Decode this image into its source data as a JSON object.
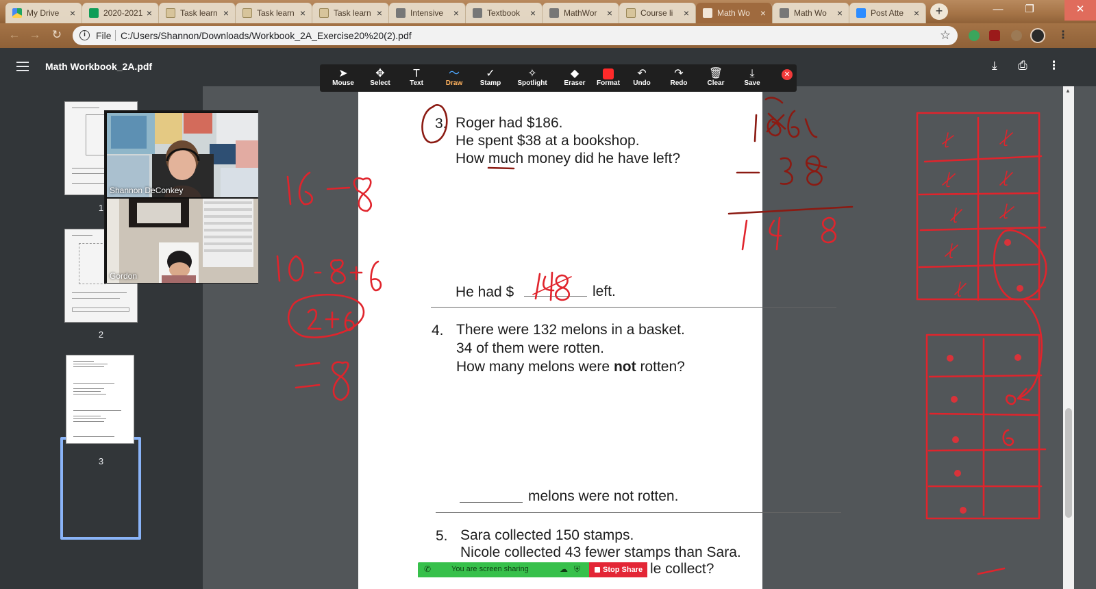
{
  "browser": {
    "tabs": [
      {
        "label": "My Drive",
        "icon": "google-drive-icon",
        "fav": "fav-drive",
        "active": false
      },
      {
        "label": "2020-2021",
        "icon": "google-sheets-icon",
        "fav": "fav-sheets",
        "active": false
      },
      {
        "label": "Task learn",
        "icon": "document-icon",
        "fav": "fav-task",
        "active": false
      },
      {
        "label": "Task learn",
        "icon": "document-icon",
        "fav": "fav-task",
        "active": false
      },
      {
        "label": "Task learn",
        "icon": "document-icon",
        "fav": "fav-task",
        "active": false
      },
      {
        "label": "Intensive",
        "icon": "globe-icon",
        "fav": "fav-globe",
        "active": false
      },
      {
        "label": "Textbook",
        "icon": "globe-icon",
        "fav": "fav-globe",
        "active": false
      },
      {
        "label": "MathWor",
        "icon": "globe-icon",
        "fav": "fav-globe",
        "active": false
      },
      {
        "label": "Course li",
        "icon": "document-icon",
        "fav": "fav-task",
        "active": false
      },
      {
        "label": "Math Wo",
        "icon": "globe-icon",
        "fav": "fav-globe-w",
        "active": true
      },
      {
        "label": "Math Wo",
        "icon": "globe-icon",
        "fav": "fav-globe",
        "active": false
      },
      {
        "label": "Post Atte",
        "icon": "zoom-icon",
        "fav": "fav-zoom",
        "active": false
      }
    ],
    "new_tab": "+",
    "address": {
      "scheme_label": "File",
      "url": "C:/Users/Shannon/Downloads/Workbook_2A_Exercise20%20(2).pdf"
    }
  },
  "viewer": {
    "title": "Math Workbook_2A.pdf",
    "thumbnails": [
      {
        "number": "1"
      },
      {
        "number": "2"
      },
      {
        "number": "3"
      }
    ]
  },
  "annotate_toolbar": {
    "tools": [
      {
        "label": "Mouse",
        "icon": "mouse-pointer-icon",
        "glyph": "➤",
        "active": false
      },
      {
        "label": "Select",
        "icon": "move-icon",
        "glyph": "✥",
        "active": false
      },
      {
        "label": "Text",
        "icon": "text-icon",
        "glyph": "T",
        "active": false
      },
      {
        "label": "Draw",
        "icon": "draw-icon",
        "glyph": "〜",
        "active": true
      },
      {
        "label": "Stamp",
        "icon": "stamp-check-icon",
        "glyph": "✓",
        "active": false
      },
      {
        "label": "Spotlight",
        "icon": "spotlight-wand-icon",
        "glyph": "✧",
        "active": false
      },
      {
        "label": "Eraser",
        "icon": "eraser-icon",
        "glyph": "◆",
        "active": false
      },
      {
        "label": "Format",
        "icon": "format-color-icon",
        "glyph": "",
        "active": false
      },
      {
        "label": "Undo",
        "icon": "undo-icon",
        "glyph": "↶",
        "active": false
      },
      {
        "label": "Redo",
        "icon": "redo-icon",
        "glyph": "↷",
        "active": false
      },
      {
        "label": "Clear",
        "icon": "trash-icon",
        "glyph": "🗑",
        "active": false
      },
      {
        "label": "Save",
        "icon": "save-icon",
        "glyph": "⤓",
        "active": false
      }
    ],
    "format_color": "#ff2a2a"
  },
  "participants": [
    {
      "name": "Shannon DeConkey"
    },
    {
      "name": "Gordon"
    }
  ],
  "worksheet": {
    "q3": {
      "number": "3.",
      "line1": "Roger had $186.",
      "line2": "He spent $38 at a bookshop.",
      "line3": "How much money did he have left?",
      "answer_prefix": "He had $",
      "answer_suffix": "left."
    },
    "q4": {
      "number": "4.",
      "line1": "There were 132 melons in a basket.",
      "line2": "34 of them were rotten.",
      "line3_pre": "How many melons were",
      "line3_bold": "not",
      "line3_post": "rotten?",
      "answer_suffix": "melons were not rotten."
    },
    "q5": {
      "number": "5.",
      "line1": "Sara collected 150 stamps.",
      "line2": "Nicole collected 43 fewer stamps than Sara.",
      "line3": "le collect?"
    }
  },
  "share_bar": {
    "status": "You are screen sharing",
    "stop_label": "Stop Share"
  },
  "colors": {
    "ink": "#e0242c",
    "active_tool": "#ffb25e",
    "share_green": "#37c04b",
    "stop_red": "#e32636"
  }
}
